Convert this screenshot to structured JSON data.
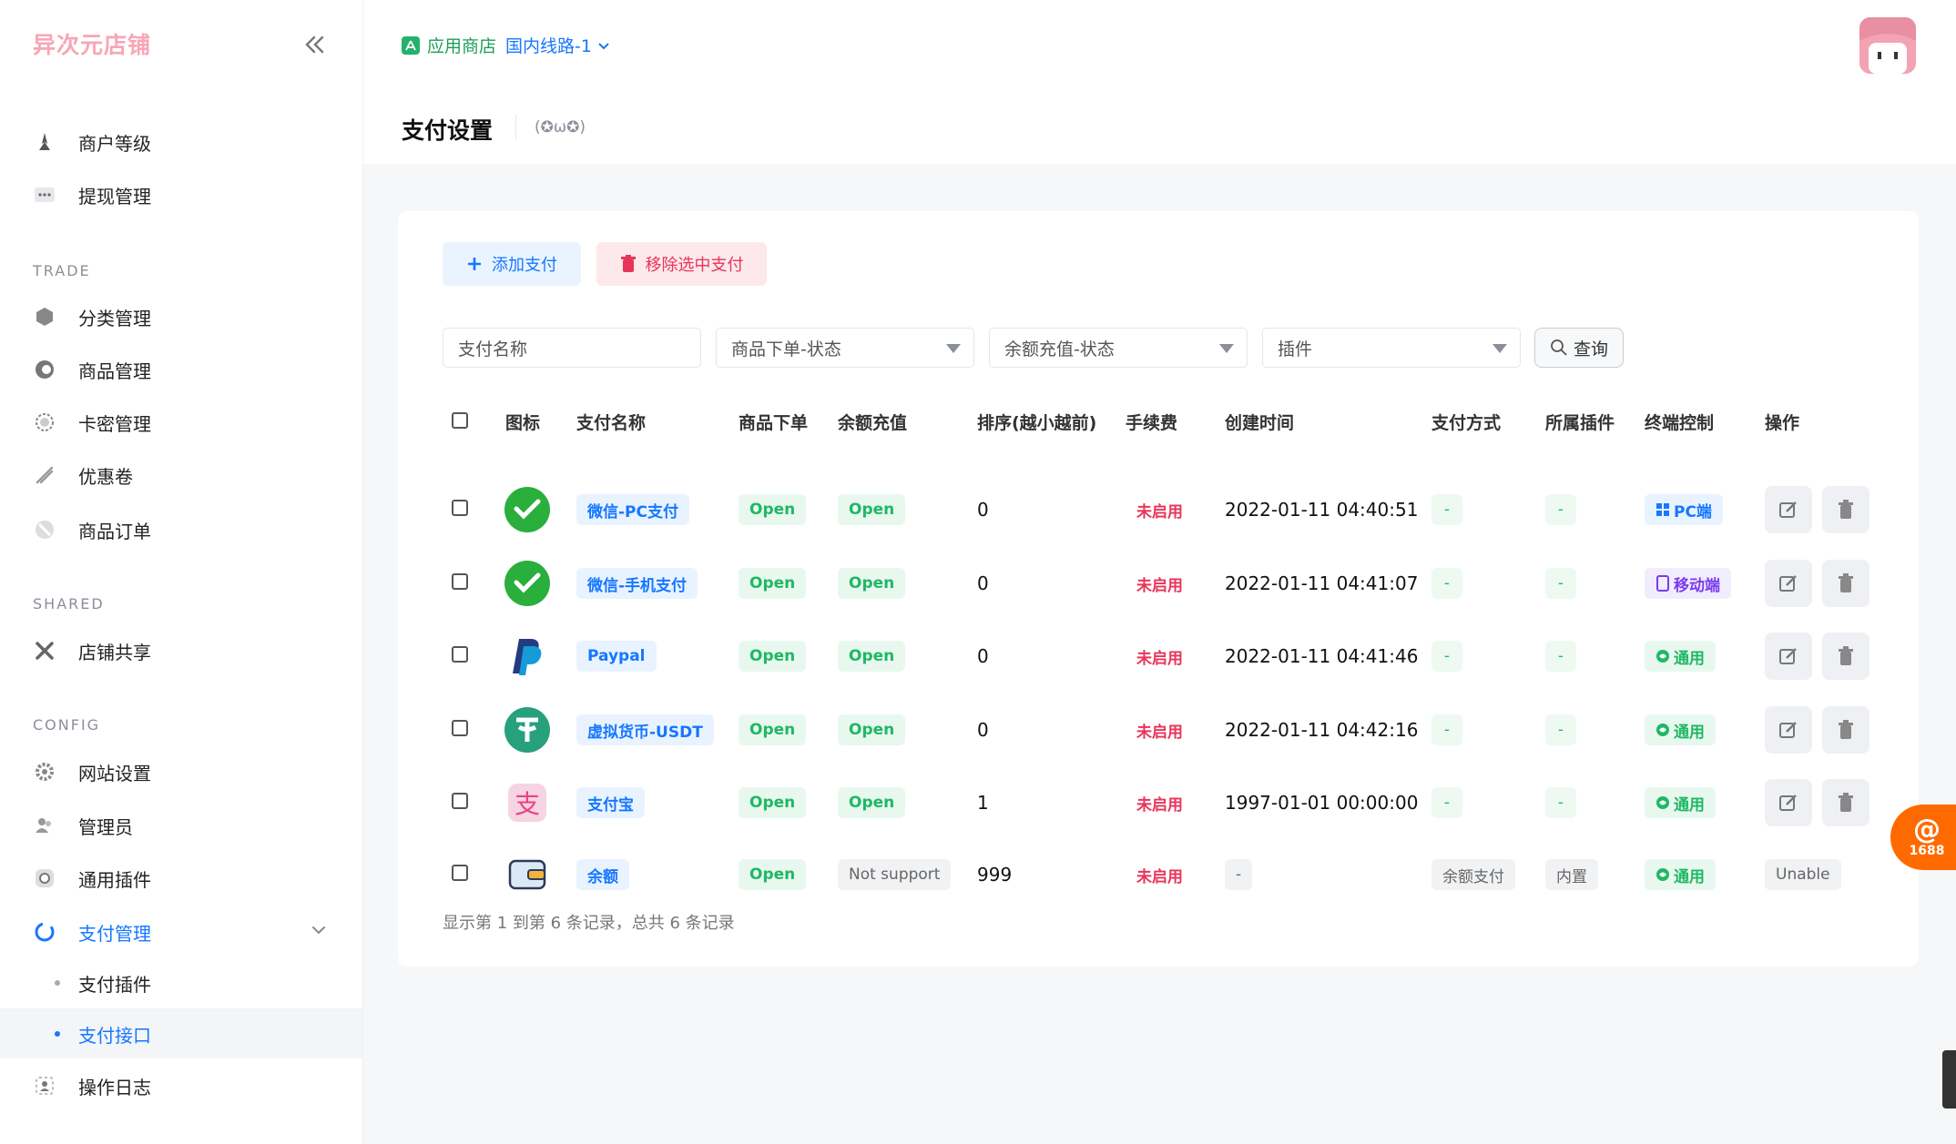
{
  "brand": "异次元店铺",
  "sidebar": {
    "top_items": [
      {
        "label": "商户等级",
        "icon": "rocket-icon"
      },
      {
        "label": "提现管理",
        "icon": "dots-icon"
      }
    ],
    "sections": [
      {
        "title": "TRADE",
        "items": [
          {
            "label": "分类管理",
            "icon": "cube-icon"
          },
          {
            "label": "商品管理",
            "icon": "product-icon"
          },
          {
            "label": "卡密管理",
            "icon": "sun-icon"
          },
          {
            "label": "优惠卷",
            "icon": "coupon-icon"
          },
          {
            "label": "商品订单",
            "icon": "order-icon"
          }
        ]
      },
      {
        "title": "SHARED",
        "items": [
          {
            "label": "店铺共享",
            "icon": "share-icon"
          }
        ]
      },
      {
        "title": "CONFIG",
        "items": [
          {
            "label": "网站设置",
            "icon": "gear-icon"
          },
          {
            "label": "管理员",
            "icon": "users-icon"
          },
          {
            "label": "通用插件",
            "icon": "plugin-icon"
          },
          {
            "label": "支付管理",
            "icon": "pay-icon"
          }
        ]
      }
    ],
    "sub_items": [
      "支付插件",
      "支付接口"
    ],
    "bottom_item": {
      "label": "操作日志",
      "icon": "log-icon"
    }
  },
  "header": {
    "store_label": "应用商店",
    "route_label": "国内线路-1",
    "page_title": "支付设置",
    "emote": "(✪ω✪)"
  },
  "toolbar": {
    "add_label": "添加支付",
    "remove_label": "移除选中支付"
  },
  "filters": {
    "name_placeholder": "支付名称",
    "order_status": "商品下单-状态",
    "recharge_status": "余额充值-状态",
    "plugin": "插件",
    "query_label": "查询"
  },
  "table": {
    "headers": [
      "图标",
      "支付名称",
      "商品下单",
      "余额充值",
      "排序(越小越前)",
      "手续费",
      "创建时间",
      "支付方式",
      "所属插件",
      "终端控制",
      "操作"
    ],
    "rows": [
      {
        "icon": "wechat-icon",
        "name": "微信-PC支付",
        "order": "Open",
        "recharge": "Open",
        "sort": "0",
        "fee": "未启用",
        "created": "2022-01-11 04:40:51",
        "method": "-",
        "plugin": "-",
        "terminal": "PC端",
        "terminal_type": "pc",
        "op": "buttons"
      },
      {
        "icon": "wechat-icon",
        "name": "微信-手机支付",
        "order": "Open",
        "recharge": "Open",
        "sort": "0",
        "fee": "未启用",
        "created": "2022-01-11 04:41:07",
        "method": "-",
        "plugin": "-",
        "terminal": "移动端",
        "terminal_type": "mobile",
        "op": "buttons"
      },
      {
        "icon": "paypal-icon",
        "name": "Paypal",
        "order": "Open",
        "recharge": "Open",
        "sort": "0",
        "fee": "未启用",
        "created": "2022-01-11 04:41:46",
        "method": "-",
        "plugin": "-",
        "terminal": "通用",
        "terminal_type": "general",
        "op": "buttons"
      },
      {
        "icon": "usdt-icon",
        "name": "虚拟货币-USDT",
        "order": "Open",
        "recharge": "Open",
        "sort": "0",
        "fee": "未启用",
        "created": "2022-01-11 04:42:16",
        "method": "-",
        "plugin": "-",
        "terminal": "通用",
        "terminal_type": "general",
        "op": "buttons"
      },
      {
        "icon": "alipay-icon",
        "name": "支付宝",
        "order": "Open",
        "recharge": "Open",
        "sort": "1",
        "fee": "未启用",
        "created": "1997-01-01 00:00:00",
        "method": "-",
        "plugin": "-",
        "terminal": "通用",
        "terminal_type": "general",
        "op": "buttons"
      },
      {
        "icon": "wallet-icon",
        "name": "余额",
        "order": "Open",
        "recharge": "Not support",
        "sort": "999",
        "fee": "未启用",
        "created": "-",
        "method": "余额支付",
        "plugin": "内置",
        "terminal": "通用",
        "terminal_type": "general",
        "op": "Unable"
      }
    ],
    "footer": "显示第 1 到第 6 条记录，总共 6 条记录"
  },
  "float_badge": "1688",
  "colors": {
    "primary": "#1677ff",
    "danger": "#e8345a",
    "success": "#1fb864",
    "brand": "#f7a6b6"
  }
}
